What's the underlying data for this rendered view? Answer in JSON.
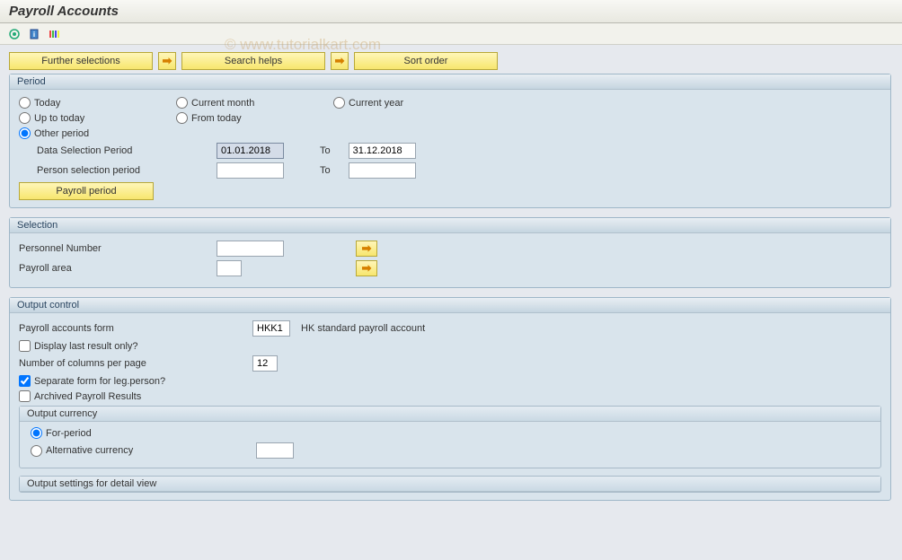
{
  "title": "Payroll Accounts",
  "watermark": "© www.tutorialkart.com",
  "buttons": {
    "further_selections": "Further selections",
    "search_helps": "Search helps",
    "sort_order": "Sort order"
  },
  "period": {
    "title": "Period",
    "options": {
      "today": "Today",
      "current_month": "Current month",
      "current_year": "Current year",
      "up_to_today": "Up to today",
      "from_today": "From today",
      "other_period": "Other period"
    },
    "data_selection_label": "Data Selection Period",
    "data_selection_from": "01.01.2018",
    "to_label": "To",
    "data_selection_to": "31.12.2018",
    "person_selection_label": "Person selection period",
    "person_selection_from": "",
    "person_selection_to": "",
    "payroll_period_btn": "Payroll period"
  },
  "selection": {
    "title": "Selection",
    "personnel_number": "Personnel Number",
    "payroll_area": "Payroll area"
  },
  "output_control": {
    "title": "Output control",
    "form_label": "Payroll accounts form",
    "form_value": "HKK1",
    "form_desc": "HK standard payroll account",
    "display_last": "Display last result only?",
    "cols_label": "Number of columns per page",
    "cols_value": "12",
    "separate_form": "Separate form for leg.person?",
    "archived": "Archived Payroll Results",
    "currency": {
      "title": "Output currency",
      "for_period": "For-period",
      "alternative": "Alternative currency"
    },
    "detail_view_title": "Output settings for detail view"
  }
}
